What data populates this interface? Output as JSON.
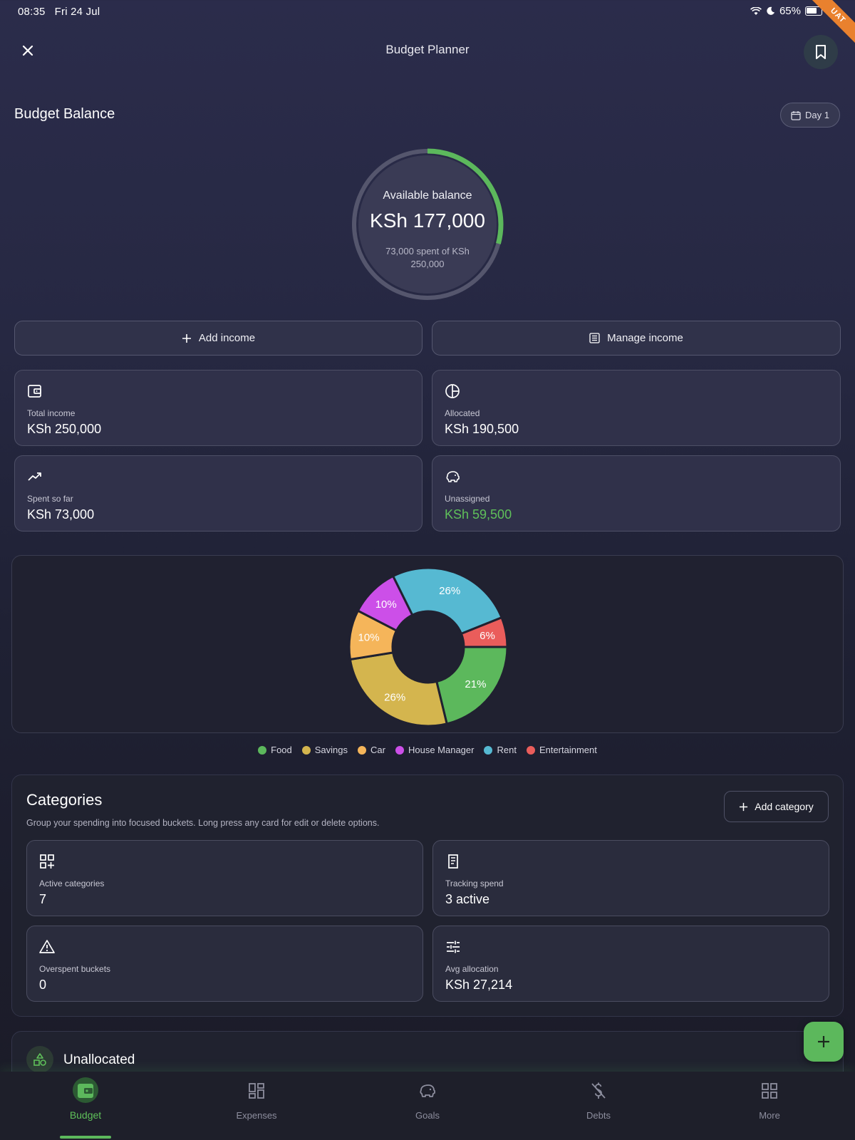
{
  "status_bar": {
    "time": "08:35",
    "date": "Fri 24 Jul",
    "battery": "65%",
    "ribbon": "UAT"
  },
  "header": {
    "title": "Budget Planner"
  },
  "balance": {
    "section_title": "Budget Balance",
    "day_chip": "Day 1",
    "ring_label": "Available balance",
    "amount": "KSh 177,000",
    "spent_text": "73,000 spent of KSh 250,000",
    "spent_fraction": 0.292
  },
  "actions": {
    "add_income": "Add income",
    "manage_income": "Manage income"
  },
  "stats": [
    {
      "label": "Total income",
      "value": "KSh 250,000"
    },
    {
      "label": "Allocated",
      "value": "KSh 190,500"
    },
    {
      "label": "Spent so far",
      "value": "KSh 73,000"
    },
    {
      "label": "Unassigned",
      "value": "KSh 59,500"
    }
  ],
  "colors": {
    "accent": "#5cb85c",
    "card": "#30314a"
  },
  "chart_data": {
    "type": "pie",
    "donut": true,
    "slices": [
      {
        "name": "Food",
        "value": 21,
        "label": "21%",
        "color": "#5cb85c"
      },
      {
        "name": "Savings",
        "value": 26,
        "label": "26%",
        "color": "#d4b54e"
      },
      {
        "name": "Car",
        "value": 10,
        "label": "10%",
        "color": "#f5b55a"
      },
      {
        "name": "House Manager",
        "value": 10,
        "label": "10%",
        "color": "#cc4fe8"
      },
      {
        "name": "Rent",
        "value": 26,
        "label": "26%",
        "color": "#56b9d2"
      },
      {
        "name": "Entertainment",
        "value": 6,
        "label": "6%",
        "color": "#ea5d5b"
      }
    ],
    "legend_position": "bottom"
  },
  "categories": {
    "title": "Categories",
    "subtitle": "Group your spending into focused buckets. Long press any card for edit or delete options.",
    "add_button": "Add category",
    "stats": [
      {
        "label": "Active categories",
        "value": "7"
      },
      {
        "label": "Tracking spend",
        "value": "3 active"
      },
      {
        "label": "Overspent buckets",
        "value": "0"
      },
      {
        "label": "Avg allocation",
        "value": "KSh 27,214"
      }
    ]
  },
  "unallocated": {
    "title": "Unallocated"
  },
  "nav": [
    {
      "label": "Budget",
      "icon": "wallet-icon",
      "active": true
    },
    {
      "label": "Expenses",
      "icon": "dashboard-icon",
      "active": false
    },
    {
      "label": "Goals",
      "icon": "piggy-bank-icon",
      "active": false
    },
    {
      "label": "Debts",
      "icon": "money-off-icon",
      "active": false
    },
    {
      "label": "More",
      "icon": "grid-icon",
      "active": false
    }
  ]
}
